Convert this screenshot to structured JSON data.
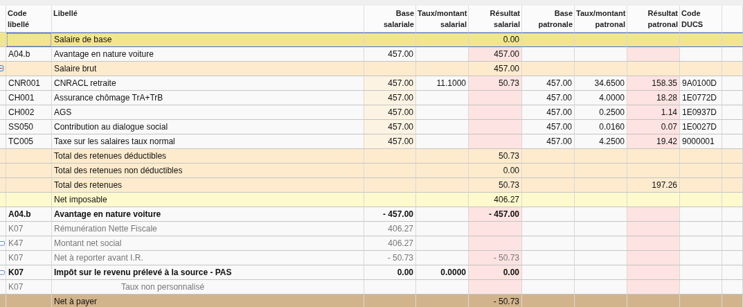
{
  "table": {
    "columns": [
      {
        "lines": [
          "Code",
          "libellé"
        ]
      },
      {
        "lines": [
          "Libellé"
        ]
      },
      {
        "lines": [
          "Base",
          "salariale"
        ]
      },
      {
        "lines": [
          "Taux/montant",
          "salarial"
        ]
      },
      {
        "lines": [
          "Résultat",
          "salarial"
        ]
      },
      {
        "lines": [
          "Base",
          "patronale"
        ]
      },
      {
        "lines": [
          "Taux/montant",
          "patronal"
        ]
      },
      {
        "lines": [
          "Résultat",
          "patronal"
        ]
      },
      {
        "lines": [
          "Code",
          "DUCS"
        ]
      }
    ],
    "rows": [
      {
        "kind": "base",
        "selected": true,
        "bold": false,
        "muted": false,
        "collapsible": false,
        "commented": false,
        "label": "Salaire de base",
        "resultat_salarial": "0.00"
      },
      {
        "kind": "line",
        "selected": false,
        "bold": false,
        "muted": false,
        "collapsible": false,
        "commented": false,
        "code": "A04.b",
        "label": "Avantage en nature voiture",
        "base_salariale": "457.00",
        "resultat_salarial": "457.00"
      },
      {
        "kind": "subtotal",
        "selected": false,
        "bold": false,
        "muted": false,
        "collapsible": true,
        "commented": false,
        "label": "Salaire brut",
        "resultat_salarial": "457.00"
      },
      {
        "kind": "contribution",
        "selected": false,
        "bold": false,
        "muted": false,
        "collapsible": false,
        "commented": false,
        "code": "CNR001",
        "label": "CNRACL retraite",
        "base_salariale": "457.00",
        "taux_salarial": "11.1000",
        "resultat_salarial": "50.73",
        "base_patronale": "457.00",
        "taux_patronal": "34.6500",
        "resultat_patronal": "158.35",
        "code_ducs": "9A0100D"
      },
      {
        "kind": "contribution",
        "selected": false,
        "bold": false,
        "muted": false,
        "collapsible": false,
        "commented": false,
        "code": "CH001",
        "label": "Assurance chômage TrA+TrB",
        "base_salariale": "457.00",
        "base_patronale": "457.00",
        "taux_patronal": "4.0000",
        "resultat_patronal": "18.28",
        "code_ducs": "1E0772D"
      },
      {
        "kind": "contribution",
        "selected": false,
        "bold": false,
        "muted": false,
        "collapsible": false,
        "commented": false,
        "code": "CH002",
        "label": "AGS",
        "base_salariale": "457.00",
        "base_patronale": "457.00",
        "taux_patronal": "0.2500",
        "resultat_patronal": "1.14",
        "code_ducs": "1E0937D"
      },
      {
        "kind": "contribution",
        "selected": false,
        "bold": false,
        "muted": false,
        "collapsible": false,
        "commented": false,
        "code": "SS050",
        "label": "Contribution au dialogue social",
        "base_salariale": "457.00",
        "base_patronale": "457.00",
        "taux_patronal": "0.0160",
        "resultat_patronal": "0.07",
        "code_ducs": "1E0027D"
      },
      {
        "kind": "contribution",
        "selected": false,
        "bold": false,
        "muted": false,
        "collapsible": false,
        "commented": false,
        "code": "TC005",
        "label": "Taxe sur les salaires taux normal",
        "base_salariale": "457.00",
        "base_patronale": "457.00",
        "taux_patronal": "4.2500",
        "resultat_patronal": "19.42",
        "code_ducs": "9000001"
      },
      {
        "kind": "subtotal",
        "selected": false,
        "bold": false,
        "muted": false,
        "collapsible": false,
        "commented": false,
        "label": "Total des retenues déductibles",
        "resultat_salarial": "50.73"
      },
      {
        "kind": "subtotal",
        "selected": false,
        "bold": false,
        "muted": false,
        "collapsible": false,
        "commented": false,
        "label": "Total des retenues non déductibles",
        "resultat_salarial": "0.00"
      },
      {
        "kind": "subtotal",
        "selected": false,
        "bold": false,
        "muted": false,
        "collapsible": false,
        "commented": false,
        "label": "Total des retenues",
        "resultat_salarial": "50.73",
        "resultat_patronal": "197.26"
      },
      {
        "kind": "taxable",
        "selected": false,
        "bold": false,
        "muted": false,
        "collapsible": false,
        "commented": false,
        "label": "Net imposable",
        "resultat_salarial": "406.27"
      },
      {
        "kind": "line",
        "selected": false,
        "bold": true,
        "muted": false,
        "collapsible": false,
        "commented": false,
        "code": "A04.b",
        "label": "Avantage en nature voiture",
        "base_salariale": "- 457.00",
        "resultat_salarial": "- 457.00"
      },
      {
        "kind": "line",
        "selected": false,
        "bold": false,
        "muted": true,
        "collapsible": false,
        "commented": false,
        "code": "K07",
        "label": "Rémunération Nette Fiscale",
        "base_salariale": "406.27"
      },
      {
        "kind": "line",
        "selected": false,
        "bold": false,
        "muted": true,
        "collapsible": false,
        "commented": true,
        "code": "K47",
        "label": "Montant net social",
        "base_salariale": "406.27"
      },
      {
        "kind": "line",
        "selected": false,
        "bold": false,
        "muted": true,
        "collapsible": false,
        "commented": false,
        "code": "K07",
        "label": "Net à reporter avant I.R.",
        "base_salariale": "- 50.73",
        "resultat_salarial": "- 50.73"
      },
      {
        "kind": "line",
        "selected": false,
        "bold": true,
        "muted": false,
        "collapsible": false,
        "commented": true,
        "code": "K07",
        "label": "Impôt sur le revenu prélevé à la source - PAS",
        "base_salariale": "0.00",
        "taux_salarial": "0.0000",
        "resultat_salarial": "0.00"
      },
      {
        "kind": "line",
        "selected": false,
        "bold": false,
        "muted": true,
        "collapsible": false,
        "commented": false,
        "indent": true,
        "code": "K07",
        "label": "Taux non personnalisé"
      },
      {
        "kind": "net",
        "selected": false,
        "bold": false,
        "muted": false,
        "collapsible": false,
        "commented": false,
        "label": "Net à payer",
        "resultat_salarial": "- 50.73"
      }
    ]
  }
}
